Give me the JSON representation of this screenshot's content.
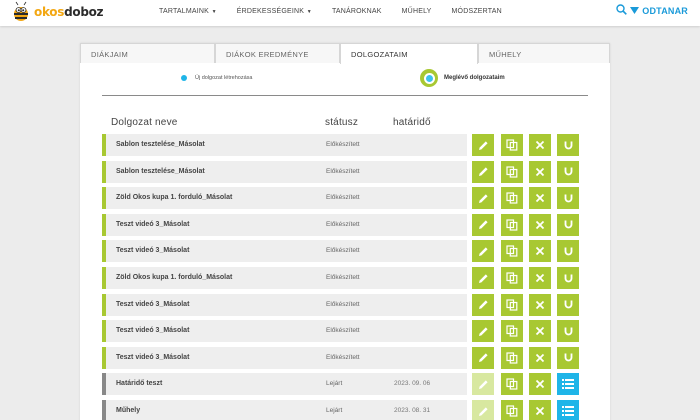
{
  "header": {
    "logo": {
      "text_okos": "okos",
      "text_doboz": "doboz"
    },
    "nav": [
      {
        "label": "TARTALMAINK",
        "has_caret": true
      },
      {
        "label": "ÉRDEKESSÉGEINK",
        "has_caret": true
      },
      {
        "label": "TANÁROKNAK",
        "has_caret": false
      },
      {
        "label": "MŰHELY",
        "has_caret": false
      },
      {
        "label": "MÓDSZERTAN",
        "has_caret": false
      }
    ],
    "user_label": "ODTANAR",
    "icons": {
      "search": "search-icon",
      "dropdown": "triangle-down-icon"
    }
  },
  "tabs": [
    {
      "label": "DIÁKJAIM",
      "active": false
    },
    {
      "label": "DIÁKOK EREDMÉNYE",
      "active": false
    },
    {
      "label": "DOLGOZATAIM",
      "active": true
    },
    {
      "label": "MŰHELY",
      "active": false
    }
  ],
  "mode": {
    "new_label": "Új dolgozat létrehozása",
    "existing_label": "Meglévő dolgozataim",
    "selected": "existing"
  },
  "table": {
    "headers": {
      "name": "Dolgozat neve",
      "status": "státusz",
      "deadline": "határidő"
    },
    "rows": [
      {
        "name": "Sablon tesztelése_Másolat",
        "status": "Előkészített",
        "deadline": "",
        "expired": false
      },
      {
        "name": "Sablon tesztelése_Másolat",
        "status": "Előkészített",
        "deadline": "",
        "expired": false
      },
      {
        "name": "Zöld Okos kupa 1. forduló_Másolat",
        "status": "Előkészített",
        "deadline": "",
        "expired": false
      },
      {
        "name": "Teszt videó 3_Másolat",
        "status": "Előkészített",
        "deadline": "",
        "expired": false
      },
      {
        "name": "Teszt videó 3_Másolat",
        "status": "Előkészített",
        "deadline": "",
        "expired": false
      },
      {
        "name": "Zöld Okos kupa 1. forduló_Másolat",
        "status": "Előkészített",
        "deadline": "",
        "expired": false
      },
      {
        "name": "Teszt videó 3_Másolat",
        "status": "Előkészített",
        "deadline": "",
        "expired": false
      },
      {
        "name": "Teszt videó 3_Másolat",
        "status": "Előkészített",
        "deadline": "",
        "expired": false
      },
      {
        "name": "Teszt videó 3_Másolat",
        "status": "Előkészített",
        "deadline": "",
        "expired": false
      },
      {
        "name": "Határidő teszt",
        "status": "Lejárt",
        "deadline": "2023. 09. 06",
        "expired": true
      },
      {
        "name": "Műhely",
        "status": "Lejárt",
        "deadline": "2023. 08. 31",
        "expired": true
      }
    ],
    "actions": [
      "edit-pencil-icon",
      "copy-icon",
      "delete-x-icon",
      "assign-magnet-icon",
      "results-list-icon"
    ]
  },
  "colors": {
    "accent_green": "#a8c832",
    "accent_blue": "#1fb5e8",
    "disabled_green": "#d8e8a0",
    "expired_bar": "#888888"
  }
}
